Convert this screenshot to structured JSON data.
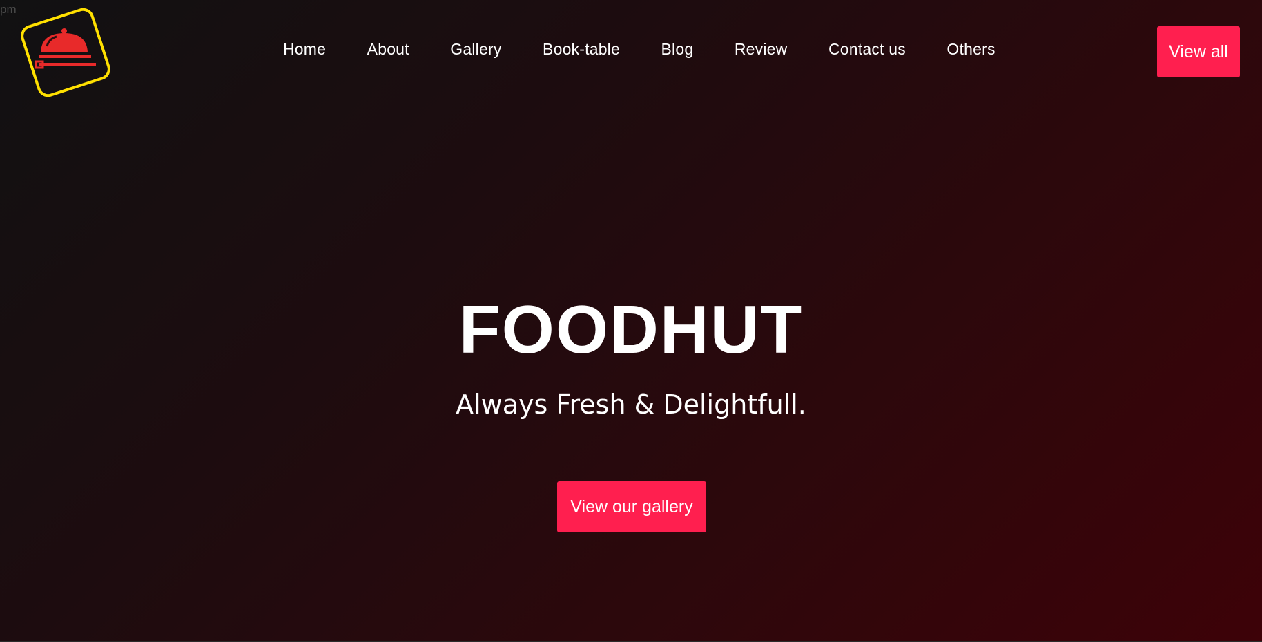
{
  "corner_text": "pm",
  "colors": {
    "accent": "#ff1f4f",
    "logo_border": "#ffe000",
    "logo_icon": "#e82a2a"
  },
  "logo": {
    "icon": "cloche-dish-icon"
  },
  "nav": {
    "items": [
      {
        "label": "Home"
      },
      {
        "label": "About"
      },
      {
        "label": "Gallery"
      },
      {
        "label": "Book-table"
      },
      {
        "label": "Blog"
      },
      {
        "label": "Review"
      },
      {
        "label": "Contact us"
      },
      {
        "label": "Others"
      }
    ],
    "cta_label": "View all"
  },
  "hero": {
    "title": "FOODHUT",
    "subtitle": "Always Fresh & Delightfull.",
    "button_label": "View our gallery"
  }
}
